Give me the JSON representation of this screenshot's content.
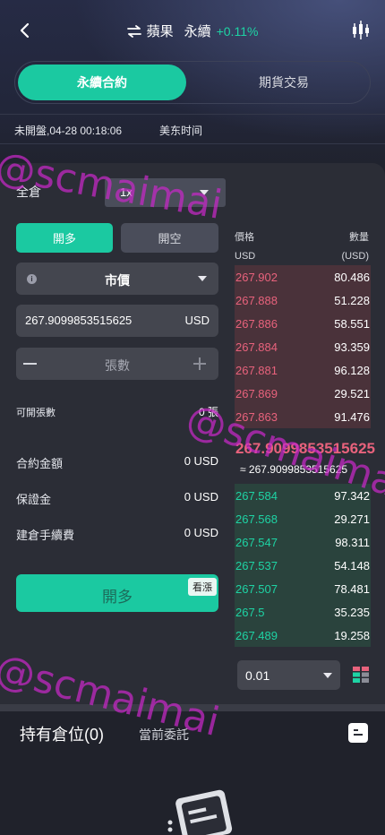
{
  "header": {
    "symbol": "蘋果",
    "contract_type": "永續",
    "change_pct": "+0.11%"
  },
  "tabs": [
    {
      "label": "永續合約",
      "active": true
    },
    {
      "label": "期貨交易",
      "active": false
    }
  ],
  "market_status": {
    "state_time": "未開盤,04-28 00:18:06",
    "timezone": "美东时间"
  },
  "order_form": {
    "margin_mode": "全倉",
    "leverage": "1x",
    "long_label": "開多",
    "short_label": "開空",
    "order_type": "市價",
    "price_value": "267.9099853515625",
    "price_unit": "USD",
    "quantity_placeholder": "張數",
    "available_label": "可開張數",
    "available_value": "0 張",
    "contract_amount_label": "合約金額",
    "contract_amount_value": "0 USD",
    "margin_label": "保證金",
    "margin_value": "0 USD",
    "fee_label": "建倉手續費",
    "fee_value": "0 USD",
    "submit_label": "開多",
    "submit_badge": "看漲"
  },
  "order_book": {
    "price_header": "價格",
    "price_unit": "USD",
    "qty_header": "數量",
    "qty_unit": "(USD)",
    "asks": [
      {
        "price": "267.902",
        "qty": "80.486"
      },
      {
        "price": "267.888",
        "qty": "51.228"
      },
      {
        "price": "267.886",
        "qty": "58.551"
      },
      {
        "price": "267.884",
        "qty": "93.359"
      },
      {
        "price": "267.881",
        "qty": "96.128"
      },
      {
        "price": "267.869",
        "qty": "29.521"
      },
      {
        "price": "267.863",
        "qty": "91.476"
      }
    ],
    "last_price": "267.9099853515625",
    "approx_price": "≈ 267.9099853515625",
    "bids": [
      {
        "price": "267.584",
        "qty": "97.342"
      },
      {
        "price": "267.568",
        "qty": "29.271"
      },
      {
        "price": "267.547",
        "qty": "98.311"
      },
      {
        "price": "267.537",
        "qty": "54.148"
      },
      {
        "price": "267.507",
        "qty": "78.481"
      },
      {
        "price": "267.5",
        "qty": "35.235"
      },
      {
        "price": "267.489",
        "qty": "19.258"
      }
    ],
    "depth": "0.01"
  },
  "positions": {
    "title": "持有倉位(0)",
    "orders_tab": "當前委託"
  },
  "watermark": "@scmaimai",
  "colors": {
    "accent": "#1bc9a1",
    "ask": "#e8627c",
    "bid": "#1ed3a4",
    "card": "#2b2d36"
  }
}
